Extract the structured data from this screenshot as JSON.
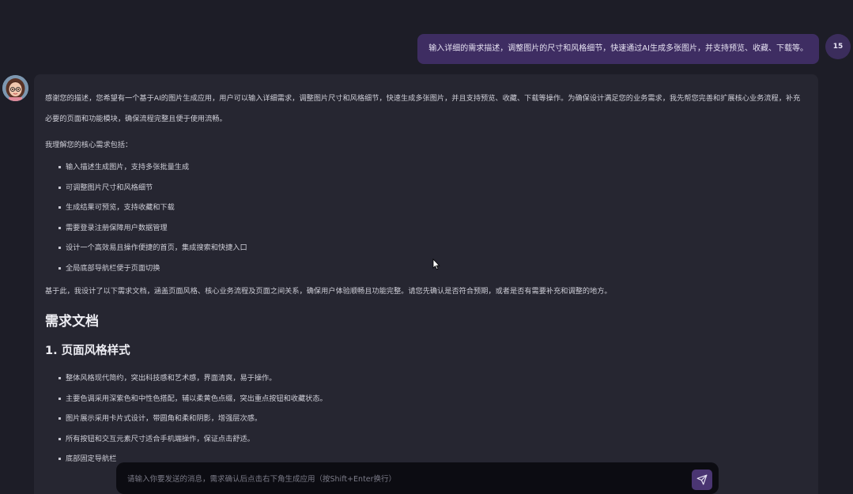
{
  "user_message": {
    "text": "输入详细的需求描述，调整图片的尺寸和风格细节，快速通过AI生成多张图片，并支持预览、收藏、下载等。",
    "avatar_label": "15"
  },
  "assistant": {
    "avatar_icon": "cartoon-girl-avatar",
    "intro": "感谢您的描述，您希望有一个基于AI的图片生成应用，用户可以输入详细需求，调整图片尺寸和风格细节，快速生成多张图片，并且支持预览、收藏、下载等操作。为确保设计满足您的业务需求，我先帮您完善和扩展核心业务流程，补充必要的页面和功能模块，确保流程完整且便于使用流畅。",
    "understanding_heading": "我理解您的核心需求包括：",
    "needs": [
      "输入描述生成图片，支持多张批量生成",
      "可调整图片尺寸和风格细节",
      "生成结果可预览，支持收藏和下载",
      "需要登录注册保障用户数据管理",
      "设计一个高效易且操作便捷的首页，集成搜索和快捷入口",
      "全局底部导航栏便于页面切换"
    ],
    "summary": "基于此，我设计了以下需求文档，涵盖页面风格、核心业务流程及页面之间关系，确保用户体验顺畅且功能完整。请您先确认是否符合预期，或者是否有需要补充和调整的地方。",
    "doc_title": "需求文档",
    "section1_title": "1. 页面风格样式",
    "style_points": [
      "整体风格现代简约，突出科技感和艺术感，界面清爽，易于操作。",
      "主要色调采用深紫色和中性色搭配，辅以柔黄色点缀，突出重点按钮和收藏状态。",
      "图片展示采用卡片式设计，带圆角和柔和阴影，增强层次感。",
      "所有按钮和交互元素尺寸适合手机端操作，保证点击舒适。",
      "底部固定导航栏"
    ]
  },
  "composer": {
    "placeholder": "请输入你要发送的消息，需求确认后点击右下角生成应用（按Shift+Enter换行）",
    "send_icon": "send-icon"
  },
  "colors": {
    "background": "#1d1d27",
    "bubble_user": "#3e2d62",
    "bubble_assistant": "#262631",
    "send_button": "#4a3572"
  }
}
